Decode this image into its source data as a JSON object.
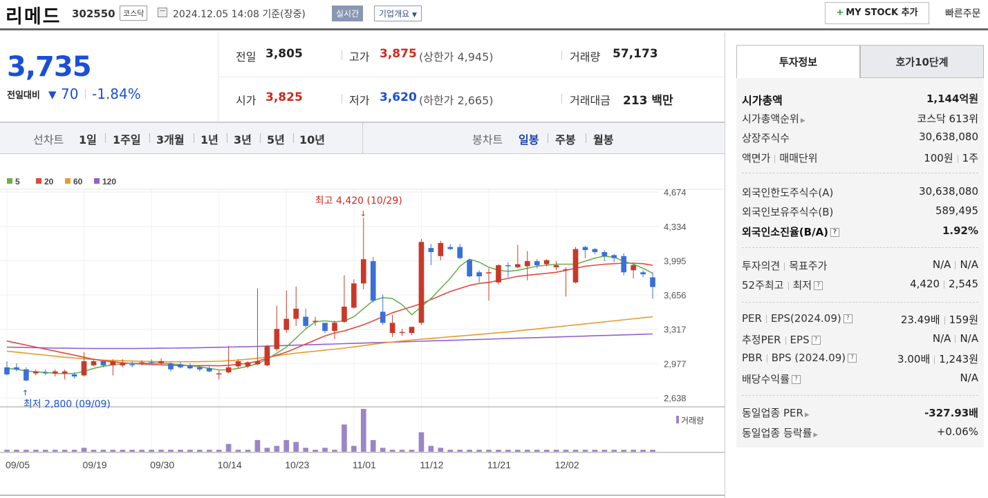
{
  "header": {
    "stock_name": "리메드",
    "stock_code": "302550",
    "market": "코스닥",
    "datetime": "2024.12.05 14:08",
    "basis": "기준(장중)",
    "realtime_label": "실시간",
    "corp_overview_label": "기업개요",
    "mystock_label": "MY STOCK 추가",
    "quick_order_label": "빠른주문"
  },
  "price": {
    "current": "3,735",
    "diff_label": "전일대비",
    "diff_value": "70",
    "diff_pct": "-1.84%",
    "prev_close_label": "전일",
    "prev_close": "3,805",
    "high_label": "고가",
    "high": "3,875",
    "upper_limit": "(상한가 4,945)",
    "volume_label": "거래량",
    "volume": "57,173",
    "open_label": "시가",
    "open": "3,825",
    "low_label": "저가",
    "low": "3,620",
    "lower_limit": "(하한가 2,665)",
    "amount_label": "거래대금",
    "amount": "213 백만"
  },
  "period_bar": {
    "line_label": "선차트",
    "line_items": [
      "1일",
      "1주일",
      "3개월",
      "1년",
      "3년",
      "5년",
      "10년"
    ],
    "candle_label": "봉차트",
    "candle_items": [
      "일봉",
      "주봉",
      "월봉"
    ],
    "active_candle": "일봉"
  },
  "chart_data": {
    "type": "candlestick",
    "period": "일봉",
    "legend": [
      {
        "name": "5",
        "color": "#6ab04c"
      },
      {
        "name": "20",
        "color": "#e0483c"
      },
      {
        "name": "60",
        "color": "#e89a2c"
      },
      {
        "name": "120",
        "color": "#9160d0"
      }
    ],
    "y_ticks": [
      "4,674",
      "4,334",
      "3,995",
      "3,656",
      "3,317",
      "2,977",
      "2,638"
    ],
    "y_tick_values": [
      4674,
      4334,
      3995,
      3656,
      3317,
      2977,
      2638
    ],
    "ylim": [
      2638,
      4674
    ],
    "x_labels": [
      {
        "label": "09/05",
        "index": 0
      },
      {
        "label": "09/19",
        "index": 8
      },
      {
        "label": "09/30",
        "index": 15
      },
      {
        "label": "10/14",
        "index": 22
      },
      {
        "label": "10/23",
        "index": 29
      },
      {
        "label": "11/01",
        "index": 36
      },
      {
        "label": "11/12",
        "index": 43
      },
      {
        "label": "11/21",
        "index": 50
      },
      {
        "label": "12/02",
        "index": 57
      }
    ],
    "annotations": {
      "high": "최고 4,420 (10/29)",
      "low": "최저 2,800 (09/09)"
    },
    "volume_label": "거래량",
    "candles": [
      {
        "o": 2940,
        "h": 3000,
        "l": 2860,
        "c": 2870
      },
      {
        "o": 2940,
        "h": 2980,
        "l": 2900,
        "c": 2920
      },
      {
        "o": 2920,
        "h": 2940,
        "l": 2800,
        "c": 2810
      },
      {
        "o": 2880,
        "h": 2920,
        "l": 2860,
        "c": 2900
      },
      {
        "o": 2890,
        "h": 2920,
        "l": 2860,
        "c": 2880
      },
      {
        "o": 2880,
        "h": 2920,
        "l": 2850,
        "c": 2900
      },
      {
        "o": 2880,
        "h": 2920,
        "l": 2820,
        "c": 2900
      },
      {
        "o": 2870,
        "h": 2890,
        "l": 2830,
        "c": 2850
      },
      {
        "o": 2860,
        "h": 3090,
        "l": 2850,
        "c": 3000
      },
      {
        "o": 2960,
        "h": 3020,
        "l": 2950,
        "c": 3000
      },
      {
        "o": 3000,
        "h": 3000,
        "l": 2940,
        "c": 2960
      },
      {
        "o": 2960,
        "h": 3020,
        "l": 2860,
        "c": 3000
      },
      {
        "o": 2960,
        "h": 3020,
        "l": 2940,
        "c": 2980
      },
      {
        "o": 2970,
        "h": 3000,
        "l": 2940,
        "c": 2960
      },
      {
        "o": 2980,
        "h": 3010,
        "l": 2960,
        "c": 2990
      },
      {
        "o": 2990,
        "h": 3020,
        "l": 2970,
        "c": 2980
      },
      {
        "o": 2980,
        "h": 3030,
        "l": 2970,
        "c": 3000
      },
      {
        "o": 2980,
        "h": 2990,
        "l": 2900,
        "c": 2920
      },
      {
        "o": 2970,
        "h": 2990,
        "l": 2930,
        "c": 2940
      },
      {
        "o": 2960,
        "h": 2980,
        "l": 2920,
        "c": 2930
      },
      {
        "o": 2940,
        "h": 2960,
        "l": 2900,
        "c": 2920
      },
      {
        "o": 2930,
        "h": 2950,
        "l": 2890,
        "c": 2900
      },
      {
        "o": 2880,
        "h": 2910,
        "l": 2820,
        "c": 2880
      },
      {
        "o": 2890,
        "h": 3150,
        "l": 2880,
        "c": 2940
      },
      {
        "o": 2950,
        "h": 3020,
        "l": 2930,
        "c": 3000
      },
      {
        "o": 2950,
        "h": 3000,
        "l": 2930,
        "c": 2990
      },
      {
        "o": 2970,
        "h": 3720,
        "l": 2960,
        "c": 3000
      },
      {
        "o": 2960,
        "h": 3160,
        "l": 2950,
        "c": 3150
      },
      {
        "o": 3120,
        "h": 3550,
        "l": 3100,
        "c": 3320
      },
      {
        "o": 3310,
        "h": 3700,
        "l": 3280,
        "c": 3420
      },
      {
        "o": 3420,
        "h": 3740,
        "l": 3350,
        "c": 3520
      },
      {
        "o": 3440,
        "h": 3520,
        "l": 3330,
        "c": 3350
      },
      {
        "o": 3390,
        "h": 3440,
        "l": 3350,
        "c": 3400
      },
      {
        "o": 3380,
        "h": 3380,
        "l": 3280,
        "c": 3300
      },
      {
        "o": 3300,
        "h": 3400,
        "l": 3220,
        "c": 3380
      },
      {
        "o": 3390,
        "h": 3850,
        "l": 3380,
        "c": 3540
      },
      {
        "o": 3530,
        "h": 3810,
        "l": 3520,
        "c": 3770
      },
      {
        "o": 3770,
        "h": 4420,
        "l": 3710,
        "c": 4010
      },
      {
        "o": 3990,
        "h": 4030,
        "l": 3580,
        "c": 3600
      },
      {
        "o": 3490,
        "h": 3660,
        "l": 3360,
        "c": 3380
      },
      {
        "o": 3280,
        "h": 3460,
        "l": 3240,
        "c": 3380
      },
      {
        "o": 3280,
        "h": 3320,
        "l": 3250,
        "c": 3290
      },
      {
        "o": 3280,
        "h": 3340,
        "l": 3260,
        "c": 3340
      },
      {
        "o": 3380,
        "h": 4210,
        "l": 3360,
        "c": 4180
      },
      {
        "o": 4120,
        "h": 4160,
        "l": 3950,
        "c": 4080
      },
      {
        "o": 4040,
        "h": 4190,
        "l": 4000,
        "c": 4170
      },
      {
        "o": 4130,
        "h": 4160,
        "l": 4100,
        "c": 4110
      },
      {
        "o": 4130,
        "h": 4160,
        "l": 4010,
        "c": 4020
      },
      {
        "o": 4000,
        "h": 4010,
        "l": 3830,
        "c": 3840
      },
      {
        "o": 3880,
        "h": 3900,
        "l": 3780,
        "c": 3840
      },
      {
        "o": 3880,
        "h": 3920,
        "l": 3600,
        "c": 3880
      },
      {
        "o": 3780,
        "h": 3960,
        "l": 3760,
        "c": 3950
      },
      {
        "o": 3950,
        "h": 3980,
        "l": 3830,
        "c": 3940
      },
      {
        "o": 3930,
        "h": 4150,
        "l": 3920,
        "c": 3960
      },
      {
        "o": 3940,
        "h": 4090,
        "l": 3800,
        "c": 3990
      },
      {
        "o": 3990,
        "h": 4010,
        "l": 3920,
        "c": 3950
      },
      {
        "o": 3960,
        "h": 4010,
        "l": 3940,
        "c": 4000
      },
      {
        "o": 3930,
        "h": 3990,
        "l": 3900,
        "c": 3950
      },
      {
        "o": 3900,
        "h": 3930,
        "l": 3640,
        "c": 3910
      },
      {
        "o": 3780,
        "h": 4130,
        "l": 3770,
        "c": 4110
      },
      {
        "o": 4130,
        "h": 4140,
        "l": 4020,
        "c": 4100
      },
      {
        "o": 4110,
        "h": 4120,
        "l": 4060,
        "c": 4080
      },
      {
        "o": 4080,
        "h": 4100,
        "l": 3990,
        "c": 4040
      },
      {
        "o": 4050,
        "h": 4060,
        "l": 3980,
        "c": 4020
      },
      {
        "o": 4040,
        "h": 4070,
        "l": 3850,
        "c": 3880
      },
      {
        "o": 3900,
        "h": 3960,
        "l": 3820,
        "c": 3950
      },
      {
        "o": 3880,
        "h": 3900,
        "l": 3830,
        "c": 3860
      },
      {
        "o": 3830,
        "h": 3880,
        "l": 3620,
        "c": 3735
      }
    ],
    "volume_bars": [
      1,
      1,
      1,
      1,
      1,
      1,
      1,
      1,
      2,
      1,
      1,
      1,
      1,
      1,
      1,
      1,
      1,
      1,
      1,
      1,
      1,
      1,
      1,
      4,
      1,
      1,
      6,
      2,
      3,
      6,
      5,
      2,
      1,
      2,
      1,
      14,
      3,
      22,
      6,
      2,
      1,
      1,
      1,
      10,
      3,
      2,
      1,
      1,
      1,
      1,
      1,
      1,
      1,
      1,
      1,
      1,
      1,
      1,
      1,
      1,
      1,
      1,
      1,
      1,
      1,
      1,
      1,
      1
    ],
    "ma5": [
      2930,
      2920,
      2905,
      2895,
      2890,
      2880,
      2878,
      2880,
      2900,
      2930,
      2950,
      2965,
      2975,
      2980,
      2980,
      2982,
      2983,
      2975,
      2965,
      2955,
      2945,
      2930,
      2915,
      2915,
      2930,
      2950,
      2975,
      3020,
      3080,
      3140,
      3230,
      3320,
      3390,
      3400,
      3390,
      3400,
      3440,
      3520,
      3600,
      3630,
      3620,
      3560,
      3460,
      3540,
      3620,
      3720,
      3820,
      3940,
      4010,
      3980,
      3930,
      3900,
      3890,
      3900,
      3920,
      3940,
      3950,
      3960,
      3960,
      3960,
      3990,
      4020,
      4040,
      4030,
      3990,
      3960,
      3920,
      3870
    ],
    "ma20": [
      3200,
      3180,
      3160,
      3140,
      3120,
      3100,
      3080,
      3060,
      3040,
      3020,
      3005,
      2995,
      2985,
      2978,
      2972,
      2968,
      2965,
      2960,
      2958,
      2957,
      2957,
      2957,
      2955,
      2960,
      2970,
      2980,
      3000,
      3030,
      3060,
      3090,
      3130,
      3170,
      3210,
      3250,
      3280,
      3300,
      3330,
      3360,
      3400,
      3440,
      3480,
      3510,
      3540,
      3570,
      3610,
      3650,
      3690,
      3720,
      3750,
      3770,
      3780,
      3800,
      3820,
      3840,
      3850,
      3860,
      3870,
      3880,
      3900,
      3920,
      3940,
      3950,
      3960,
      3965,
      3970,
      3970,
      3965,
      3950
    ],
    "ma60": [
      3100,
      3090,
      3080,
      3070,
      3060,
      3050,
      3040,
      3032,
      3025,
      3018,
      3012,
      3008,
      3005,
      3002,
      3000,
      2998,
      2996,
      2995,
      2995,
      2995,
      2996,
      2998,
      3000,
      3005,
      3012,
      3020,
      3030,
      3042,
      3055,
      3068,
      3080,
      3090,
      3100,
      3110,
      3120,
      3130,
      3142,
      3155,
      3168,
      3180,
      3190,
      3200,
      3210,
      3218,
      3226,
      3234,
      3242,
      3250,
      3258,
      3266,
      3274,
      3282,
      3290,
      3300,
      3310,
      3320,
      3330,
      3340,
      3350,
      3360,
      3370,
      3380,
      3390,
      3400,
      3410,
      3420,
      3430,
      3440
    ],
    "ma120": [
      3140,
      3138,
      3136,
      3134,
      3132,
      3130,
      3129,
      3128,
      3127,
      3126,
      3126,
      3126,
      3126,
      3126,
      3127,
      3128,
      3129,
      3130,
      3131,
      3132,
      3134,
      3136,
      3138,
      3140,
      3142,
      3144,
      3147,
      3150,
      3153,
      3156,
      3159,
      3162,
      3165,
      3168,
      3171,
      3174,
      3177,
      3180,
      3183,
      3186,
      3189,
      3192,
      3195,
      3198,
      3201,
      3204,
      3207,
      3210,
      3213,
      3216,
      3219,
      3222,
      3225,
      3228,
      3231,
      3234,
      3237,
      3240,
      3243,
      3246,
      3249,
      3252,
      3255,
      3258,
      3261,
      3264,
      3267,
      3270
    ]
  },
  "right_panel": {
    "tabs": [
      "투자정보",
      "호가10단계"
    ],
    "rows": [
      {
        "label": "시가총액",
        "value": "1,144억원"
      },
      {
        "label": "시가총액순위",
        "value": "코스닥 613위"
      },
      {
        "label": "상장주식수",
        "value": "30,638,080"
      },
      {
        "label": "액면가",
        "label2": "매매단위",
        "value": "100원",
        "value2": "1주"
      },
      {
        "label": "외국인한도주식수(A)",
        "value": "30,638,080"
      },
      {
        "label": "외국인보유주식수(B)",
        "value": "589,495"
      },
      {
        "label": "외국인소진율(B/A)",
        "value": "1.92%"
      },
      {
        "label": "투자의견",
        "label2": "목표주가",
        "value": "N/A",
        "value2": "N/A"
      },
      {
        "label": "52주최고",
        "label2": "최저",
        "value": "4,420",
        "value2": "2,545"
      },
      {
        "label": "PER",
        "label2": "EPS(2024.09)",
        "value": "23.49배",
        "value2": "159원"
      },
      {
        "label": "추정PER",
        "label2": "EPS",
        "value": "N/A",
        "value2": "N/A"
      },
      {
        "label": "PBR",
        "label2": "BPS (2024.09)",
        "value": "3.00배",
        "value2": "1,243원"
      },
      {
        "label": "배당수익률",
        "value": "N/A"
      },
      {
        "label": "동일업종 PER",
        "value": "-327.93배"
      },
      {
        "label": "동일업종 등락률",
        "value": "+0.06%"
      }
    ]
  },
  "colors": {
    "up": "#d0281c",
    "down": "#1a4fd6",
    "candle_up": "#c8392a",
    "candle_down": "#3a6fd8",
    "volume": "#9b85c8"
  }
}
